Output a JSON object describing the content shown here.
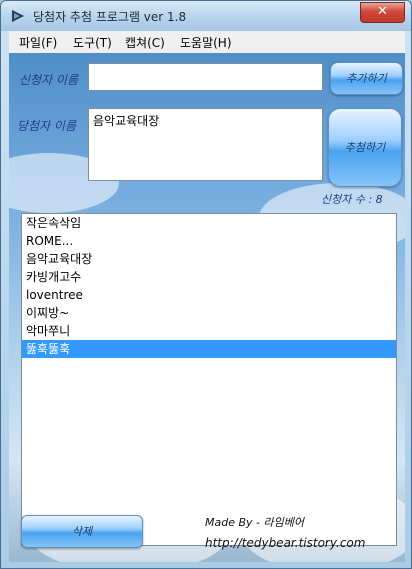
{
  "window": {
    "title": "당첨자 추첨 프로그램 ver 1.8",
    "close_label": "✕"
  },
  "menu": [
    {
      "label": "파일(F)"
    },
    {
      "label": "도구(T)"
    },
    {
      "label": "캡쳐(C)"
    },
    {
      "label": "도움말(H)"
    }
  ],
  "form": {
    "applicant_name_label": "신청자 이름",
    "applicant_name_value": "",
    "add_button_label": "추가하기",
    "winner_name_label": "당첨자 이름",
    "winner_name_value": "음악교육대장",
    "draw_button_label": "추첨하기",
    "applicant_count_label": "신청자 수 : 8"
  },
  "applicants": {
    "items": [
      "작은속삭임",
      "ROME...",
      "음악교육대장",
      "카빙개고수",
      "loventree",
      "이찌방~",
      "악마쭈니",
      "뚫훅뚫훅"
    ],
    "selected_index": 7
  },
  "footer": {
    "delete_button_label": "삭제",
    "made_by": "Made By - 라임베어",
    "url": "http://tedybear.tistory.com"
  },
  "colors": {
    "selection": "#3399ff",
    "close_button": "#c0392b"
  }
}
